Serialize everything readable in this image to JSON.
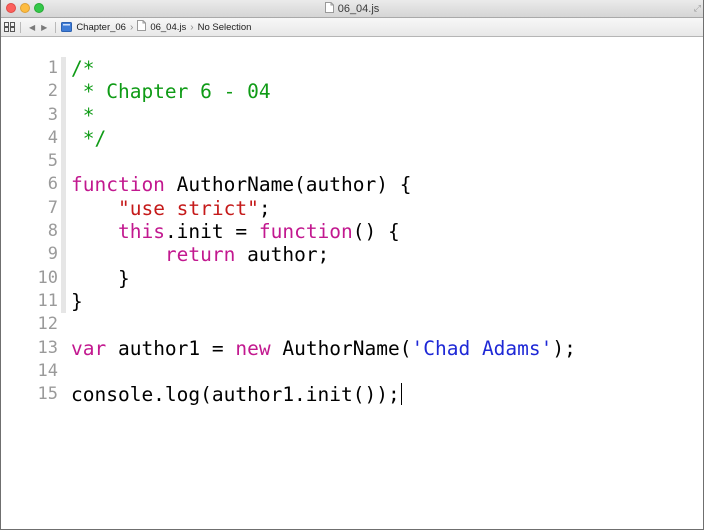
{
  "window": {
    "title": "06_04.js"
  },
  "jumpbar": {
    "crumbs": [
      "Chapter_06",
      "06_04.js",
      "No Selection"
    ]
  },
  "editor": {
    "lines": [
      {
        "num": "1",
        "segments": [
          {
            "t": "/*",
            "c": "comment"
          }
        ]
      },
      {
        "num": "2",
        "segments": [
          {
            "t": " * Chapter 6 - 04",
            "c": "comment"
          }
        ]
      },
      {
        "num": "3",
        "segments": [
          {
            "t": " *",
            "c": "comment"
          }
        ]
      },
      {
        "num": "4",
        "segments": [
          {
            "t": " */",
            "c": "comment"
          }
        ]
      },
      {
        "num": "5",
        "segments": []
      },
      {
        "num": "6",
        "segments": [
          {
            "t": "function",
            "c": "kw"
          },
          {
            "t": " AuthorName(author) {",
            "c": "plain"
          }
        ]
      },
      {
        "num": "7",
        "segments": [
          {
            "t": "    ",
            "c": "plain"
          },
          {
            "t": "\"use strict\"",
            "c": "str"
          },
          {
            "t": ";",
            "c": "plain"
          }
        ]
      },
      {
        "num": "8",
        "segments": [
          {
            "t": "    ",
            "c": "plain"
          },
          {
            "t": "this",
            "c": "kw"
          },
          {
            "t": ".init = ",
            "c": "plain"
          },
          {
            "t": "function",
            "c": "kw"
          },
          {
            "t": "() {",
            "c": "plain"
          }
        ]
      },
      {
        "num": "9",
        "segments": [
          {
            "t": "        ",
            "c": "plain"
          },
          {
            "t": "return",
            "c": "kw"
          },
          {
            "t": " author;",
            "c": "plain"
          }
        ]
      },
      {
        "num": "10",
        "segments": [
          {
            "t": "    }",
            "c": "plain"
          }
        ]
      },
      {
        "num": "11",
        "segments": [
          {
            "t": "}",
            "c": "plain"
          }
        ]
      },
      {
        "num": "12",
        "segments": []
      },
      {
        "num": "13",
        "segments": [
          {
            "t": "var",
            "c": "kw"
          },
          {
            "t": " author1 = ",
            "c": "plain"
          },
          {
            "t": "new",
            "c": "kw"
          },
          {
            "t": " AuthorName(",
            "c": "plain"
          },
          {
            "t": "'Chad Adams'",
            "c": "str2"
          },
          {
            "t": ");",
            "c": "plain"
          }
        ]
      },
      {
        "num": "14",
        "segments": []
      },
      {
        "num": "15",
        "segments": [
          {
            "t": "console.log(author1.init());",
            "c": "plain"
          }
        ],
        "cursor": true
      }
    ]
  }
}
